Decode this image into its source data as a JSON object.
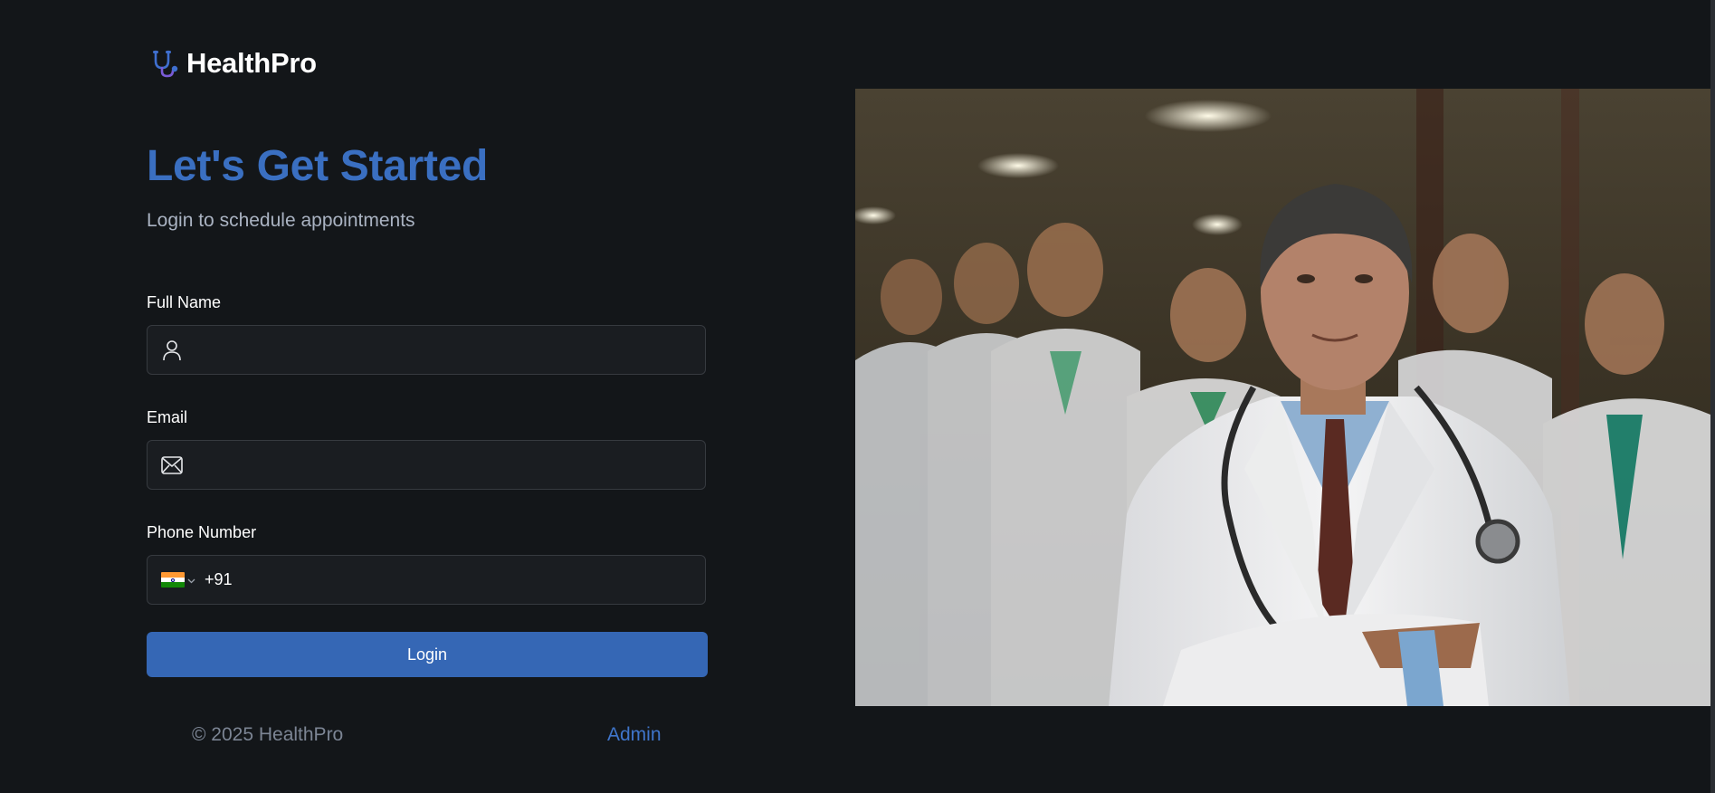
{
  "brand": {
    "name": "HealthPro",
    "icon": "stethoscope-icon",
    "accent": "#3a6fc1"
  },
  "header": {
    "title": "Let's Get Started",
    "subtitle": "Login to schedule appointments"
  },
  "form": {
    "full_name": {
      "label": "Full Name",
      "value": "",
      "icon": "user-icon"
    },
    "email": {
      "label": "Email",
      "value": "",
      "icon": "mail-icon"
    },
    "phone": {
      "label": "Phone Number",
      "country": "India",
      "code": "+91",
      "value": ""
    },
    "login_label": "Login"
  },
  "footer": {
    "copyright": "© 2025 HealthPro",
    "admin_link": "Admin"
  },
  "hero": {
    "description_icon": "doctors-photo"
  },
  "colors": {
    "background": "#131619",
    "input_bg": "#1a1d21",
    "button": "#3567b5",
    "link": "#3f75cb"
  }
}
